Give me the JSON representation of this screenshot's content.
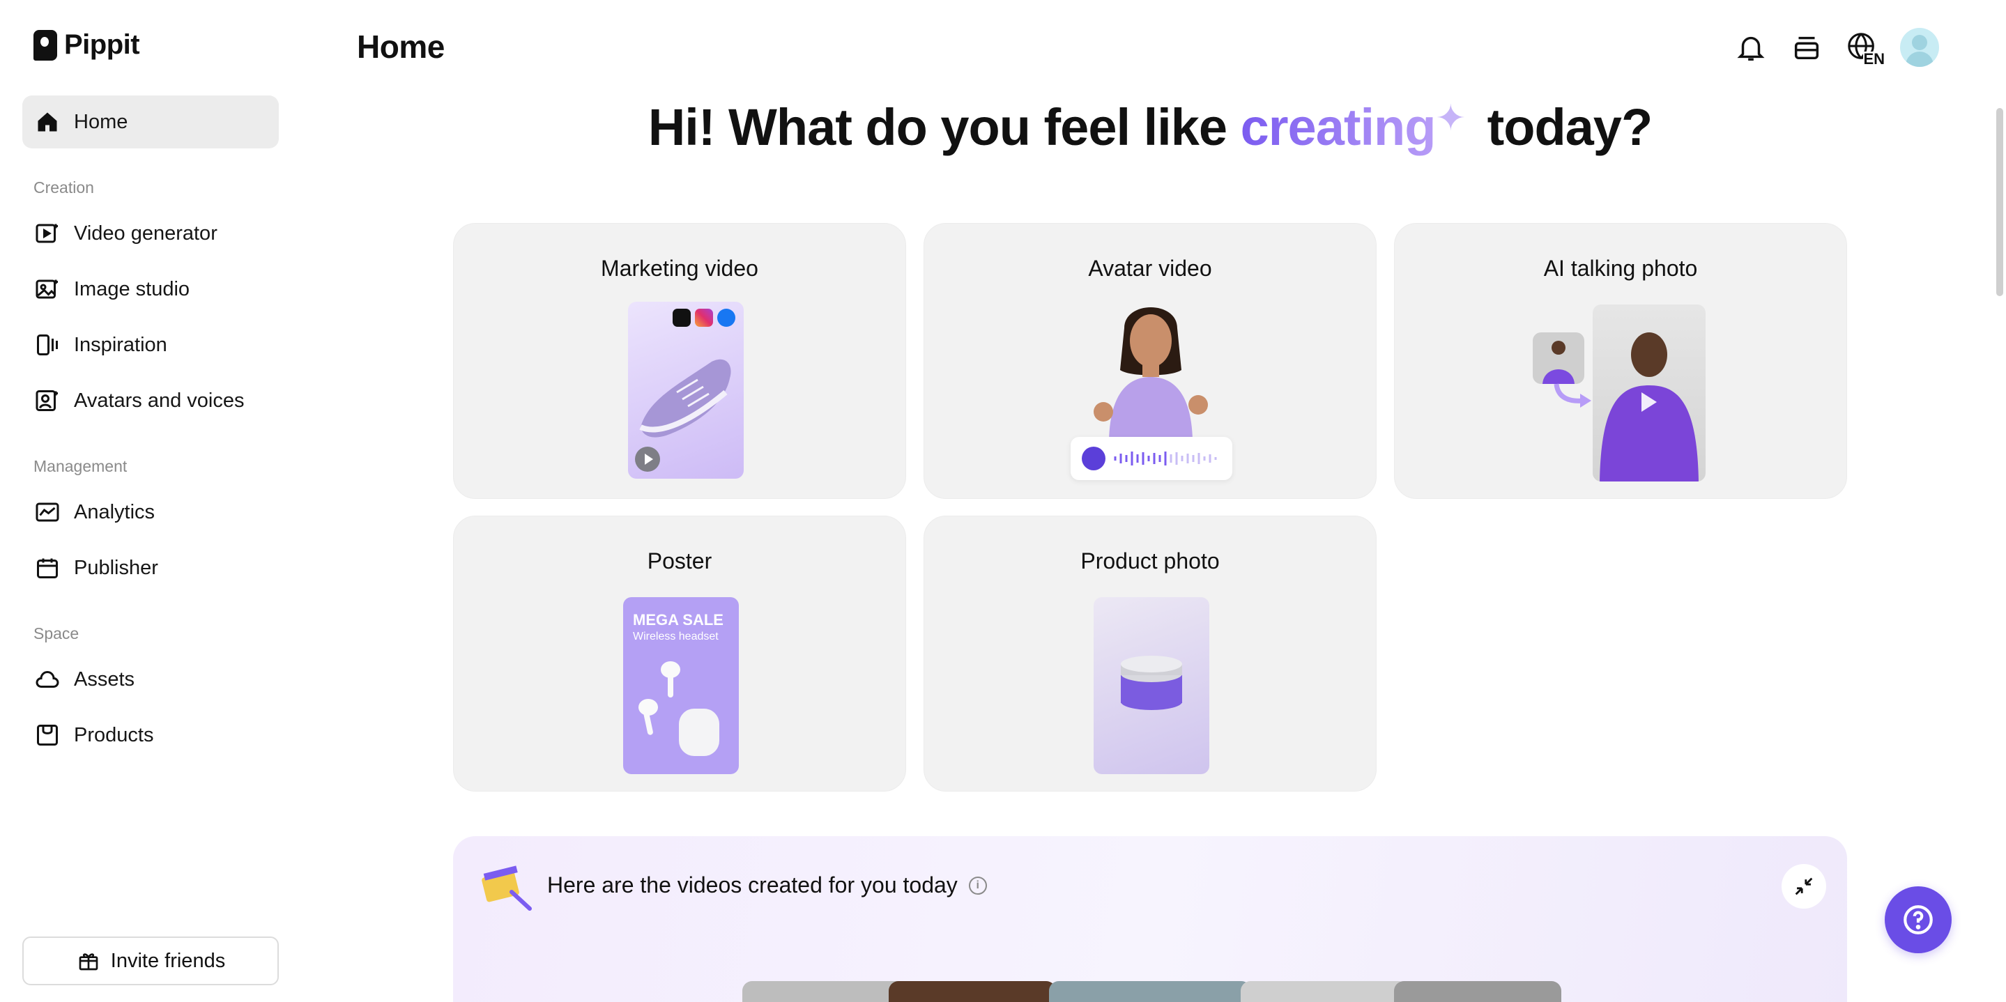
{
  "app": {
    "name": "Pippit"
  },
  "sidebar": {
    "home": "Home",
    "sections": {
      "creation": "Creation",
      "management": "Management",
      "space": "Space"
    },
    "creation_items": [
      {
        "label": "Video generator",
        "icon": "video-plus-icon"
      },
      {
        "label": "Image studio",
        "icon": "image-plus-icon"
      },
      {
        "label": "Inspiration",
        "icon": "inspiration-icon"
      },
      {
        "label": "Avatars and voices",
        "icon": "avatar-icon"
      }
    ],
    "management_items": [
      {
        "label": "Analytics",
        "icon": "analytics-icon"
      },
      {
        "label": "Publisher",
        "icon": "calendar-icon"
      }
    ],
    "space_items": [
      {
        "label": "Assets",
        "icon": "cloud-icon"
      },
      {
        "label": "Products",
        "icon": "product-icon"
      }
    ],
    "invite": "Invite friends"
  },
  "header": {
    "title": "Home",
    "language": "EN"
  },
  "hero": {
    "prefix": "Hi! What do you feel like ",
    "accent": "creating",
    "suffix": " today?"
  },
  "cards": [
    {
      "title": "Marketing video"
    },
    {
      "title": "Avatar video"
    },
    {
      "title": "AI talking photo"
    },
    {
      "title": "Poster",
      "poster_headline": "MEGA SALE",
      "poster_sub": "Wireless headset"
    },
    {
      "title": "Product photo"
    }
  ],
  "panel": {
    "title": "Here are the videos created for you today",
    "info": "i"
  },
  "colors": {
    "accent": "#6a4de6",
    "card_bg": "#f2f2f2",
    "active_nav": "#ececec"
  }
}
